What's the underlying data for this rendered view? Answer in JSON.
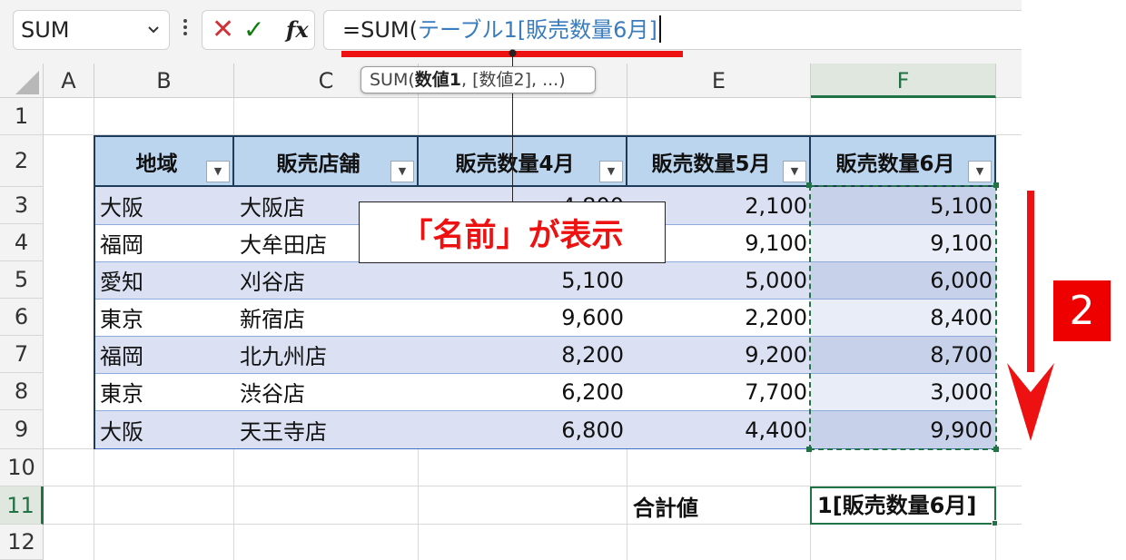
{
  "formula_bar": {
    "name_box": "SUM",
    "cancel_icon": "✕",
    "enter_icon": "✓",
    "fx_label": "fx",
    "formula_eq": "=SUM(",
    "formula_ref": "テーブル1[販売数量6月]",
    "tooltip": {
      "name": "SUM(",
      "arg1": "数値1",
      "rest": ", [数値2], ...)"
    }
  },
  "columns": [
    "A",
    "B",
    "C",
    "D",
    "E",
    "F"
  ],
  "rows": [
    "1",
    "2",
    "3",
    "4",
    "5",
    "6",
    "7",
    "8",
    "9",
    "10",
    "11",
    "12"
  ],
  "table": {
    "headers": [
      "地域",
      "販売店舗",
      "販売数量4月",
      "販売数量5月",
      "販売数量6月"
    ],
    "rows": [
      [
        "大阪",
        "大阪店",
        "4,800",
        "2,100",
        "5,100"
      ],
      [
        "福岡",
        "大牟田店",
        "",
        "9,100",
        "9,100"
      ],
      [
        "愛知",
        "刈谷店",
        "5,100",
        "5,000",
        "6,000"
      ],
      [
        "東京",
        "新宿店",
        "9,600",
        "2,200",
        "8,400"
      ],
      [
        "福岡",
        "北九州店",
        "8,200",
        "9,200",
        "8,700"
      ],
      [
        "東京",
        "渋谷店",
        "6,200",
        "7,700",
        "3,000"
      ],
      [
        "大阪",
        "天王寺店",
        "6,800",
        "4,400",
        "9,900"
      ]
    ]
  },
  "total": {
    "label": "合計値",
    "cell_text": "1[販売数量6月]"
  },
  "annotations": {
    "callout": "「名前」が表示",
    "step": "2"
  },
  "colors": {
    "accent_red": "#ee1111",
    "excel_green": "#217346",
    "table_header": "#bcd5ee",
    "band": "#dbe1f2"
  }
}
